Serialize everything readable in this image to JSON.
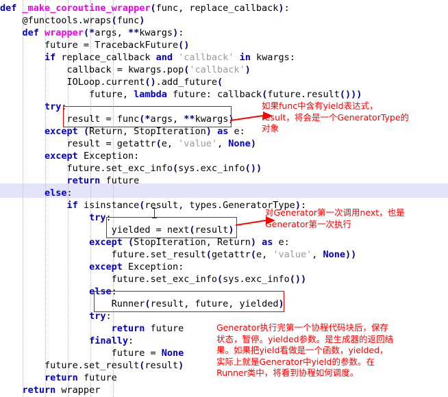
{
  "editor": {
    "language": "python",
    "background_color": "#ffffff",
    "highlighted_line_color": "#e3e3fa",
    "annotation_color": "#ff0000",
    "keyword_color": "#0000cd",
    "function_color": "#ee00ee",
    "string_color": "#9a9a9a",
    "paren_color": "#000080"
  },
  "code_lines": [
    {
      "indent": 0,
      "text": "def _make_coroutine_wrapper(func, replace_callback):"
    },
    {
      "indent": 1,
      "text": "@functools.wraps(func)"
    },
    {
      "indent": 1,
      "text": "def wrapper(*args, **kwargs):"
    },
    {
      "indent": 2,
      "text": "future = TracebackFuture()"
    },
    {
      "indent": 2,
      "text": "if replace_callback and 'callback' in kwargs:"
    },
    {
      "indent": 3,
      "text": "callback = kwargs.pop('callback')"
    },
    {
      "indent": 3,
      "text": "IOLoop.current().add_future("
    },
    {
      "indent": 4,
      "text": "future, lambda future: callback(future.result()))"
    },
    {
      "indent": 2,
      "text": "try:"
    },
    {
      "indent": 3,
      "text": "result = func(*args, **kwargs)"
    },
    {
      "indent": 2,
      "text": "except (Return, StopIteration) as e:"
    },
    {
      "indent": 3,
      "text": "result = getattr(e, 'value', None)"
    },
    {
      "indent": 2,
      "text": "except Exception:"
    },
    {
      "indent": 3,
      "text": "future.set_exc_info(sys.exc_info())"
    },
    {
      "indent": 3,
      "text": "return future"
    },
    {
      "indent": 2,
      "text": "else:"
    },
    {
      "indent": 3,
      "text": "if isinstance(result, types.GeneratorType):"
    },
    {
      "indent": 4,
      "text": "try:"
    },
    {
      "indent": 5,
      "text": "yielded = next(result)"
    },
    {
      "indent": 4,
      "text": "except (StopIteration, Return) as e:"
    },
    {
      "indent": 5,
      "text": "future.set_result(getattr(e, 'value', None))"
    },
    {
      "indent": 4,
      "text": "except Exception:"
    },
    {
      "indent": 5,
      "text": "future.set_exc_info(sys.exc_info())"
    },
    {
      "indent": 4,
      "text": "else:"
    },
    {
      "indent": 5,
      "text": "Runner(result, future, yielded)"
    },
    {
      "indent": 4,
      "text": "try:"
    },
    {
      "indent": 5,
      "text": "return future"
    },
    {
      "indent": 4,
      "text": "finally:"
    },
    {
      "indent": 5,
      "text": "future = None"
    },
    {
      "indent": 2,
      "text": "future.set_result(result)"
    },
    {
      "indent": 2,
      "text": "return future"
    },
    {
      "indent": 1,
      "text": "return wrapper"
    }
  ],
  "highlighted_line_index": 15,
  "highlight_boxes": [
    {
      "name": "box-result-func",
      "line_index": 9
    },
    {
      "name": "box-yielded-next",
      "line_index": 18
    },
    {
      "name": "box-runner",
      "line_index": 24
    }
  ],
  "annotations": [
    {
      "id": "annot-result-generatortype",
      "text": "如果func中含有yield表达式，\nresult，将会是一个GeneratorType的\n对象"
    },
    {
      "id": "annot-generator-first-next",
      "text": "对Generator第一次调用next，也是\nGenerator第一次执行"
    },
    {
      "id": "annot-yielded-explanation",
      "text": "Generator执行完第一个协程代码块后，保存\n状态，暂停。yielded参数。是生成器的返回结\n果。如果把yield看做是一个函数，yielded，\n实际上就是Generator中yield的参数。在\nRunner类中，将看到协程如何调度。"
    }
  ]
}
